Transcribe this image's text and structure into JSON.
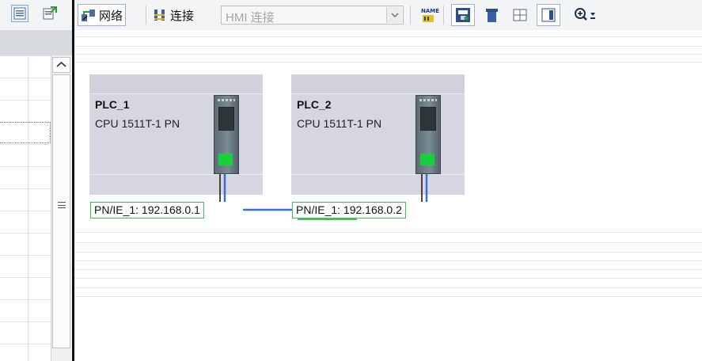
{
  "toolbar": {
    "network_label": "网络",
    "connections_label": "连接",
    "hmi_connection_value": "HMI 连接",
    "name_icon_text": "NAME"
  },
  "devices": [
    {
      "name": "PLC_1",
      "type": "CPU 1511T-1 PN",
      "interface_label": "PN/IE_1:  192.168.0.1"
    },
    {
      "name": "PLC_2",
      "type": "CPU 1511T-1 PN",
      "interface_label": "PN/IE_1:  192.168.0.2"
    }
  ],
  "colors": {
    "subnet_line": "#3b6fd6",
    "port_active": "#16d13b",
    "device_bg": "#d5d6df"
  }
}
